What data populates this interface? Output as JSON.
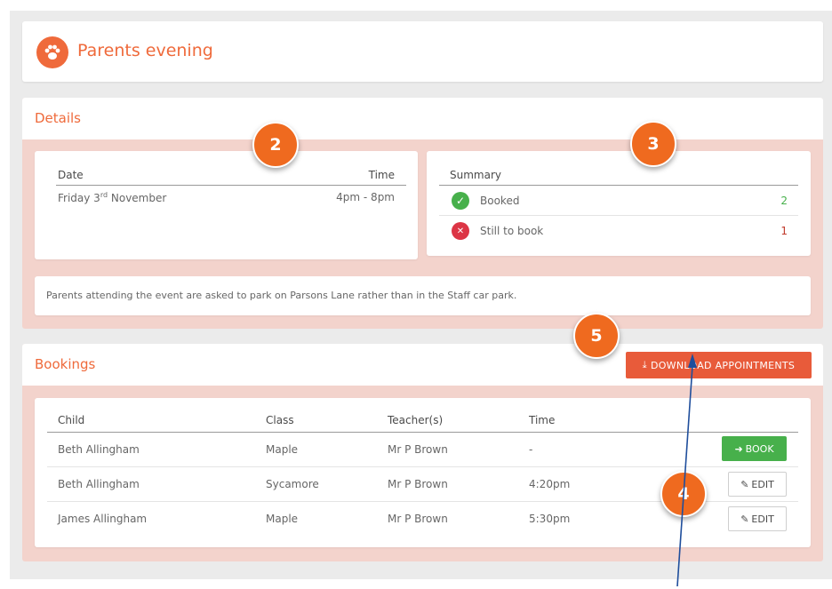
{
  "page": {
    "title": "Parents evening",
    "icon": "paw-icon"
  },
  "details": {
    "title": "Details",
    "date_header": "Date",
    "time_header": "Time",
    "date_value": "Friday 3",
    "date_suffix": "rd",
    "date_month": " November",
    "time_value": "4pm - 8pm",
    "summary_header": "Summary",
    "booked_label": "Booked",
    "booked_count": "2",
    "still_label": "Still to book",
    "still_count": "1",
    "note": "Parents attending the event are asked to park on Parsons Lane rather than in the Staff car park."
  },
  "bookings": {
    "title": "Bookings",
    "download_label": "DOWNLOAD APPOINTMENTS",
    "columns": [
      "Child",
      "Class",
      "Teacher(s)",
      "Time"
    ],
    "rows": [
      {
        "child": "Beth Allingham",
        "class": "Maple",
        "teacher": "Mr P Brown",
        "time": "-",
        "action": "BOOK"
      },
      {
        "child": "Beth Allingham",
        "class": "Sycamore",
        "teacher": "Mr P Brown",
        "time": "4:20pm",
        "action": "EDIT"
      },
      {
        "child": "James Allingham",
        "class": "Maple",
        "teacher": "Mr P Brown",
        "time": "5:30pm",
        "action": "EDIT"
      }
    ]
  },
  "callouts": {
    "two": "2",
    "three": "3",
    "four": "4",
    "five": "5"
  },
  "colors": {
    "accent": "#ef6a3b",
    "booked": "#47b04b",
    "still": "#dc3545",
    "badge": "#ef6a1f",
    "arrow": "#1f4e9c"
  }
}
